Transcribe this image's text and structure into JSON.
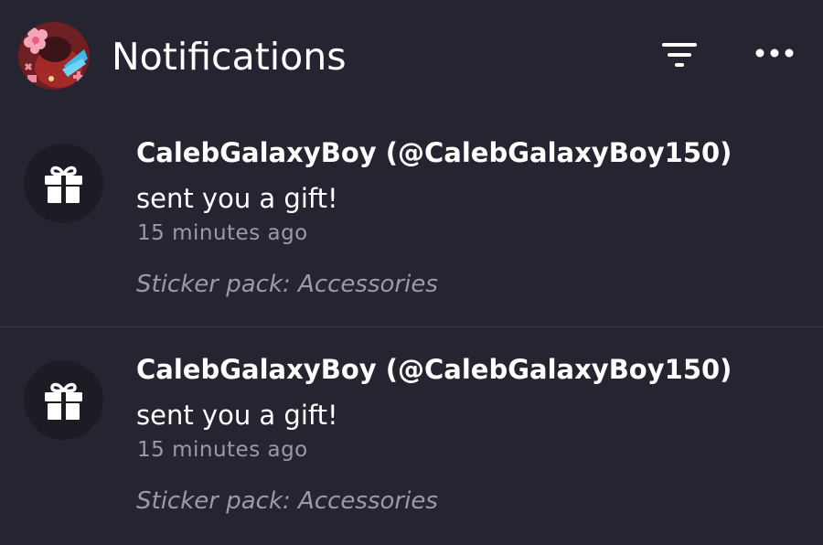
{
  "header": {
    "title": "Notifications",
    "avatar_icon": "user-avatar",
    "filter_icon": "filter-icon",
    "more_icon": "more-options-icon"
  },
  "notifications": [
    {
      "icon": "gift-icon",
      "title": "CalebGalaxyBoy (@CalebGalaxyBoy150)",
      "body": "sent you a gift!",
      "time": "15 minutes ago",
      "detail": "Sticker pack: Accessories"
    },
    {
      "icon": "gift-icon",
      "title": "CalebGalaxyBoy (@CalebGalaxyBoy150)",
      "body": "sent you a gift!",
      "time": "15 minutes ago",
      "detail": "Sticker pack: Accessories"
    }
  ],
  "colors": {
    "background": "#242530",
    "icon_circle": "#1b1c24",
    "secondary_text": "#9a9ba6",
    "divider": "#3a3b47"
  }
}
